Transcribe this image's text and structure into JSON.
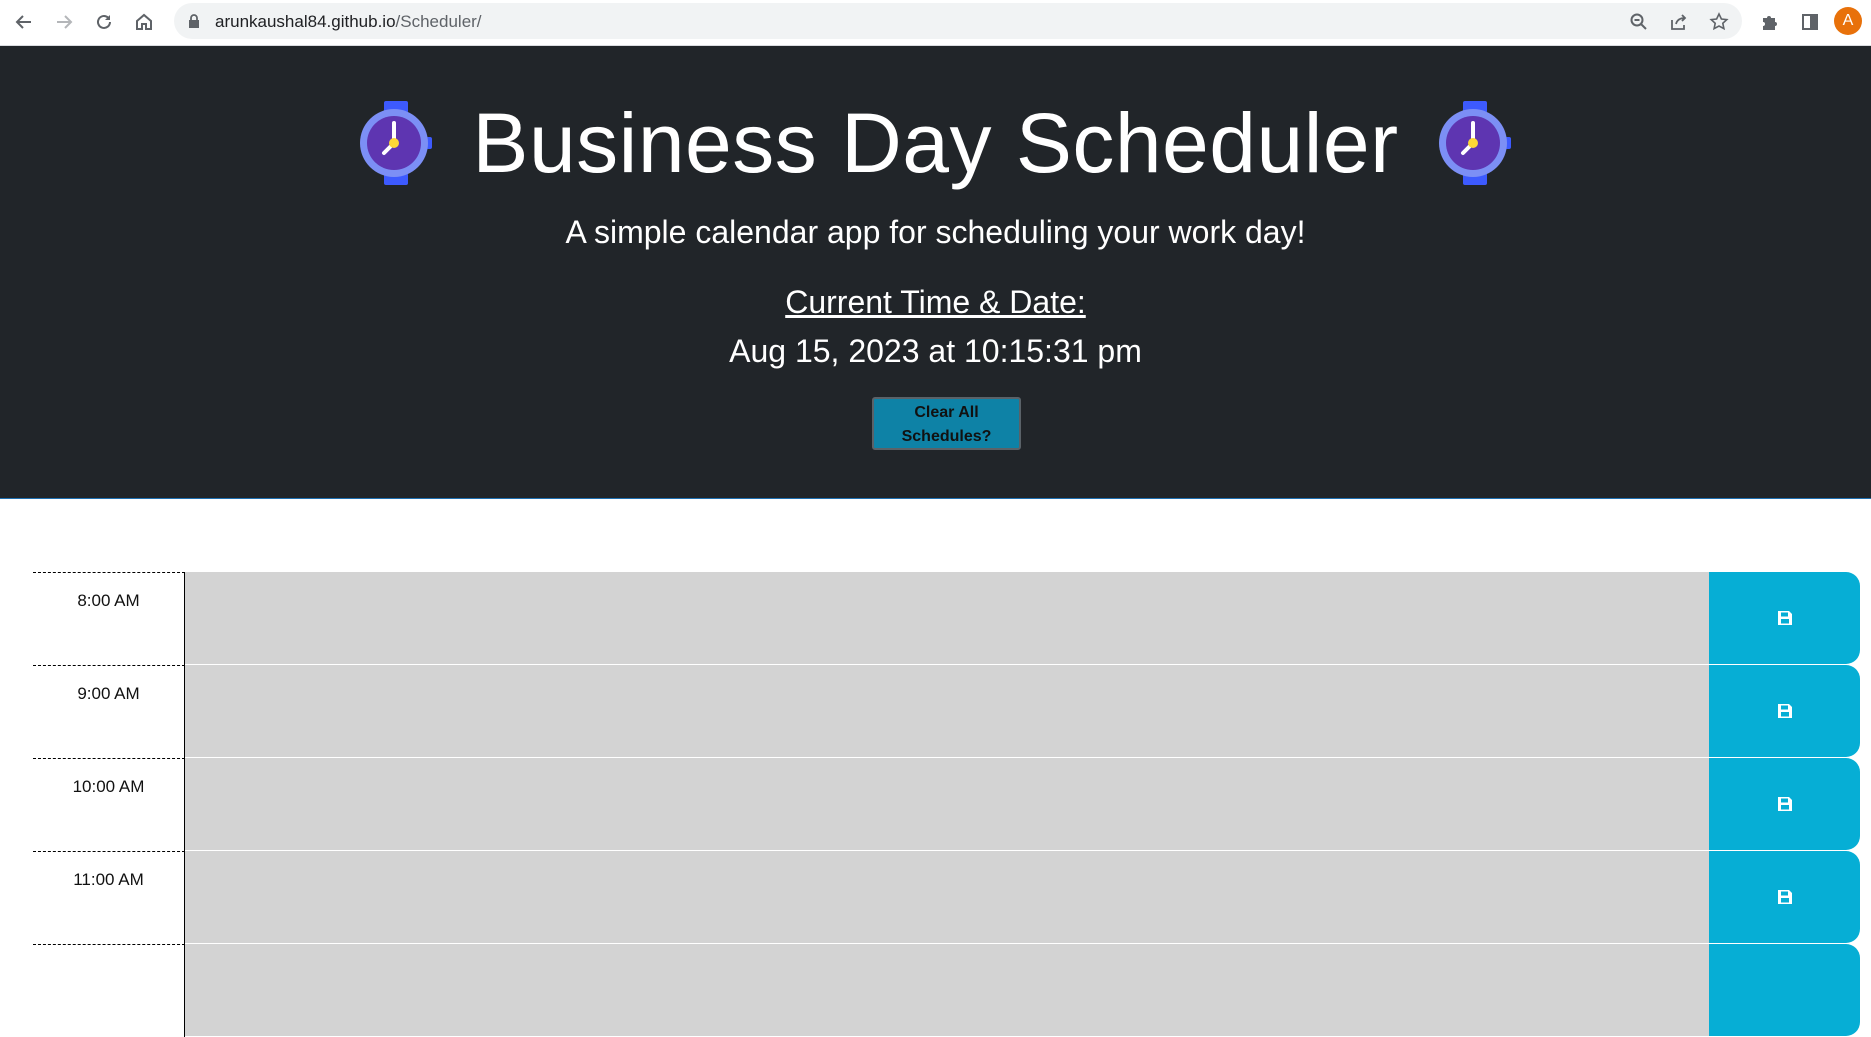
{
  "browser": {
    "url_host": "arunkaushal84.github.io",
    "url_path": "/Scheduler/",
    "avatar_letter": "A"
  },
  "header": {
    "title": "Business Day Scheduler",
    "subtitle": "A simple calendar app for scheduling your work day!",
    "time_label": "Current Time & Date:",
    "current_time": "Aug 15, 2023 at 10:15:31 pm",
    "clear_button_line1": "Clear All",
    "clear_button_line2": "Schedules?"
  },
  "schedule": {
    "hours": [
      "8:00 AM",
      "9:00 AM",
      "10:00 AM",
      "11:00 AM",
      ""
    ],
    "save_icon": "floppy-disk-icon"
  },
  "colors": {
    "header_bg": "#212529",
    "past_block": "#d3d3d3",
    "save_button": "#06aed5",
    "clear_button": "#0e82a6"
  }
}
